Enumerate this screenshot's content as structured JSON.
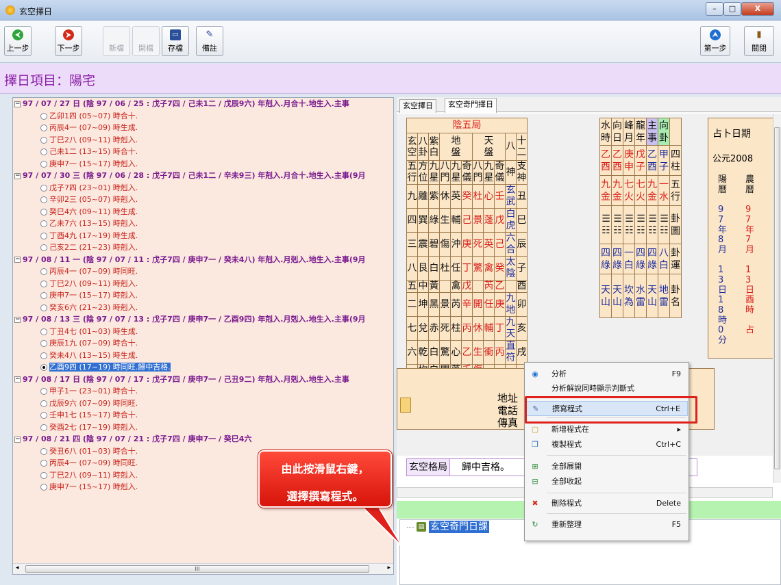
{
  "window": {
    "title": "玄空擇日",
    "min": "–",
    "max": "□",
    "close": "X"
  },
  "toolbar": {
    "buttons": [
      {
        "label": "上一步",
        "icon": "back-icon",
        "glyph": "⮜",
        "enabled": true
      },
      {
        "label": "下一步",
        "icon": "forward-icon",
        "glyph": "⮞",
        "enabled": true
      },
      {
        "label": "新檔",
        "icon": "",
        "glyph": "",
        "enabled": false
      },
      {
        "label": "開檔",
        "icon": "",
        "glyph": "",
        "enabled": false
      },
      {
        "label": "存檔",
        "icon": "save-icon",
        "glyph": "▭",
        "enabled": true
      },
      {
        "label": "備註",
        "icon": "memo-icon",
        "glyph": "✎",
        "enabled": true
      }
    ],
    "right_buttons": [
      {
        "label": "第一步",
        "icon": "first-step-icon",
        "glyph": "⮝"
      },
      {
        "label": "關閉",
        "icon": "exit-door-icon",
        "glyph": "▮"
      }
    ]
  },
  "section_title": "擇日項目：陽宅",
  "tree": [
    {
      "level": 0,
      "text": "97 / 07 / 27 日 (陰 97 / 06 / 25 : 戊子7四 / 己未1二 / 戊辰9六) 年剋入.月合十.地生入.主事"
    },
    {
      "level": 1,
      "text": "乙卯1四 (05~07) 時合十."
    },
    {
      "level": 1,
      "text": "丙辰4一 (07~09) 時生成."
    },
    {
      "level": 1,
      "text": "丁巳2八 (09~11) 時剋入."
    },
    {
      "level": 1,
      "text": "己未1二 (13~15) 時合十."
    },
    {
      "level": 1,
      "text": "庚申7一 (15~17) 時剋入."
    },
    {
      "level": 0,
      "text": "97 / 07 / 30 三 (陰 97 / 06 / 28 : 戊子7四 / 己未1二 / 辛未9三) 年剋入.月合十.地生入.主事(9月"
    },
    {
      "level": 1,
      "text": "戊子7四 (23~01) 時剋入."
    },
    {
      "level": 1,
      "text": "辛卯2三 (05~07) 時剋入."
    },
    {
      "level": 1,
      "text": "癸巳4六 (09~11) 時生成."
    },
    {
      "level": 1,
      "text": "乙未7六 (13~15) 時剋入."
    },
    {
      "level": 1,
      "text": "丁酉4九 (17~19) 時生成."
    },
    {
      "level": 1,
      "text": "己亥2二 (21~23) 時剋入."
    },
    {
      "level": 0,
      "text": "97 / 08 / 11 一 (陰 97 / 07 / 11 : 戊子7四 / 庚申7一 / 癸未4八) 年剋入.月剋入.地生入.主事(9月"
    },
    {
      "level": 1,
      "text": "丙辰4一 (07~09) 時同旺."
    },
    {
      "level": 1,
      "text": "丁巳2八 (09~11) 時剋入."
    },
    {
      "level": 1,
      "text": "庚申7一 (15~17) 時剋入."
    },
    {
      "level": 1,
      "text": "癸亥6六 (21~23) 時剋入."
    },
    {
      "level": 0,
      "text": "97 / 08 / 13 三 (陰 97 / 07 / 13 : 戊子7四 / 庚申7一 / 乙酉9四) 年剋入.月剋入.地生入.主事(9月"
    },
    {
      "level": 1,
      "text": "丁丑4七 (01~03) 時生成."
    },
    {
      "level": 1,
      "text": "庚辰1九 (07~09) 時合十."
    },
    {
      "level": 1,
      "text": "癸未4八 (13~15) 時生成."
    },
    {
      "level": 1,
      "text": "乙酉9四 (17~19) 時同旺.歸中吉格.",
      "selected": true
    },
    {
      "level": 0,
      "text": "97 / 08 / 17 日 (陰 97 / 07 / 17 : 戊子7四 / 庚申7一 / 己丑9二) 年剋入.月剋入.地生入.主事"
    },
    {
      "level": 1,
      "text": "甲子1一 (23~01) 時合十."
    },
    {
      "level": 1,
      "text": "戊辰9六 (07~09) 時同旺."
    },
    {
      "level": 1,
      "text": "壬申1七 (15~17) 時合十."
    },
    {
      "level": 1,
      "text": "癸酉2七 (17~19) 時剋入."
    },
    {
      "level": 0,
      "text": "97 / 08 / 21 四 (陰 97 / 07 / 21 : 戊子7四 / 庚申7一 / 癸巳4六"
    },
    {
      "level": 1,
      "text": "癸丑6八 (01~03) 時合十."
    },
    {
      "level": 1,
      "text": "丙辰4一 (07~09) 時同旺."
    },
    {
      "level": 1,
      "text": "丁巳2八 (09~11) 時剋入."
    },
    {
      "level": 1,
      "text": "庚申7一 (15~17) 時剋入."
    }
  ],
  "tabs": [
    "玄空擇日",
    "玄空奇門擇日"
  ],
  "chart": {
    "header": "陰五局",
    "rows": [
      [
        "九",
        "離",
        "紫",
        "休",
        "英",
        "癸",
        "杜",
        "心",
        "壬",
        "玄武",
        "丑"
      ],
      [
        "四",
        "巽",
        "綠",
        "生",
        "輔",
        "己",
        "景",
        "蓬",
        "戊",
        "白虎",
        "巳"
      ],
      [
        "三",
        "震",
        "碧",
        "傷",
        "沖",
        "庚",
        "死",
        "英",
        "己",
        "六合",
        "辰"
      ],
      [
        "八",
        "艮",
        "白",
        "杜",
        "任",
        "丁",
        "驚",
        "禽",
        "癸",
        "太陰",
        "子"
      ],
      [
        "五",
        "中",
        "黃",
        "",
        "禽",
        "戊",
        "",
        "芮",
        "乙",
        "",
        "酉"
      ],
      [
        "二",
        "坤",
        "黑",
        "景",
        "芮",
        "辛",
        "開",
        "任",
        "庚",
        "九地",
        "卯"
      ],
      [
        "七",
        "兌",
        "赤",
        "死",
        "柱",
        "丙",
        "休",
        "輔",
        "丁",
        "九天",
        "亥"
      ],
      [
        "六",
        "乾",
        "白",
        "驚",
        "心",
        "乙",
        "生",
        "衝",
        "丙",
        "直符",
        "戌"
      ],
      [
        "一",
        "坎",
        "白",
        "開",
        "蓬",
        "壬",
        "傷",
        "",
        "",
        "",
        ""
      ]
    ],
    "side_top": [
      "水時",
      "向日",
      "峰月",
      "龍年",
      "主事",
      "向卦"
    ],
    "side_gz": [
      "乙酉",
      "乙酉",
      "庚申",
      "戊子",
      "乙酉",
      "甲子"
    ],
    "side_num": [
      "九金",
      "九金",
      "七火",
      "七火",
      "九金",
      "一水"
    ],
    "side_yun": [
      "四綠",
      "四綠",
      "一白",
      "四綠",
      "四綠",
      "八白"
    ],
    "side_gua": [
      "天山",
      "天山",
      "坎為",
      "水雷",
      "天山",
      "地雷"
    ],
    "col_labels": [
      "四柱",
      "五行",
      "卦圖",
      "卦運",
      "卦名"
    ],
    "right_head": "占卜日期",
    "right_year": "公元2008",
    "right_cols": [
      [
        "陽曆",
        "97年",
        "8月",
        "13日",
        "18時",
        "0分"
      ],
      [
        "農曆",
        "97年",
        "7月",
        "13日",
        "酉時",
        "占"
      ]
    ]
  },
  "address_lines": [
    "地址",
    "電話",
    "傳真"
  ],
  "result": {
    "label": "玄空格局",
    "value": "歸中吉格。"
  },
  "tree_root": "玄空奇門日課",
  "context_menu": [
    {
      "label": "分析",
      "shortcut": "F9",
      "icon": "analyze-icon"
    },
    {
      "label": "分析解說同時顯示判斷式",
      "shortcut": "",
      "icon": ""
    },
    {
      "label": "撰寫程式",
      "shortcut": "Ctrl+E",
      "icon": "write-program-icon",
      "highlight": true
    },
    {
      "label": "新增程式在",
      "shortcut": "▸",
      "icon": "new-program-icon"
    },
    {
      "label": "複製程式",
      "shortcut": "Ctrl+C",
      "icon": "copy-icon"
    },
    {
      "label": "全部展開",
      "shortcut": "",
      "icon": "expand-all-icon"
    },
    {
      "label": "全部收起",
      "shortcut": "",
      "icon": "collapse-all-icon"
    },
    {
      "label": "刪除程式",
      "shortcut": "Delete",
      "icon": "delete-icon"
    },
    {
      "label": "重新整理",
      "shortcut": "F5",
      "icon": "refresh-icon"
    }
  ],
  "callout": {
    "line1": "由此按滑鼠右鍵，",
    "line2": "選擇撰寫程式。"
  }
}
